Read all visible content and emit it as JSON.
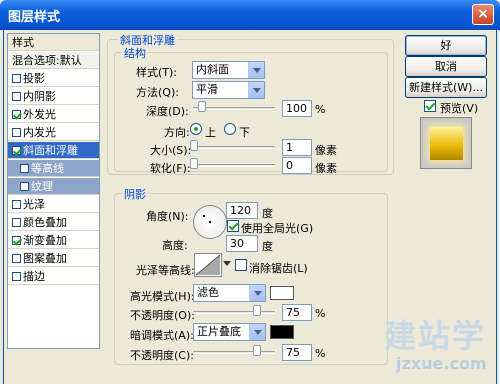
{
  "window": {
    "title": "图层样式",
    "close": "×"
  },
  "styles_list": {
    "header": "样式",
    "blend_options": "混合选项:默认",
    "items": [
      {
        "label": "投影",
        "checked": false
      },
      {
        "label": "内阴影",
        "checked": false
      },
      {
        "label": "外发光",
        "checked": true
      },
      {
        "label": "内发光",
        "checked": false
      },
      {
        "label": "斜面和浮雕",
        "checked": true,
        "selected": true
      },
      {
        "label": "等高线",
        "checked": false,
        "sub": true
      },
      {
        "label": "纹理",
        "checked": false,
        "sub": true
      },
      {
        "label": "光泽",
        "checked": false
      },
      {
        "label": "颜色叠加",
        "checked": false
      },
      {
        "label": "渐变叠加",
        "checked": true
      },
      {
        "label": "图案叠加",
        "checked": false
      },
      {
        "label": "描边",
        "checked": false
      }
    ]
  },
  "bevel": {
    "group_title": "斜面和浮雕",
    "structure_title": "结构",
    "style_label": "样式(T):",
    "style_value": "内斜面",
    "technique_label": "方法(Q):",
    "technique_value": "平滑",
    "depth_label": "深度(D):",
    "depth_value": "100",
    "depth_unit": "%",
    "direction_label": "方向:",
    "direction_up": "上",
    "direction_down": "下",
    "size_label": "大小(S):",
    "size_value": "1",
    "size_unit": "像素",
    "soften_label": "软化(F):",
    "soften_value": "0",
    "soften_unit": "像素"
  },
  "shading": {
    "title": "阴影",
    "angle_label": "角度(N):",
    "angle_value": "120",
    "angle_unit": "度",
    "global_light_label": "使用全局光(G)",
    "altitude_label": "高度:",
    "altitude_value": "30",
    "altitude_unit": "度",
    "gloss_label": "光泽等高线:",
    "anti_alias_label": "消除锯齿(L)",
    "highlight_label": "高光模式(H):",
    "highlight_value": "滤色",
    "highlight_opacity_label": "不透明度(O):",
    "highlight_opacity_value": "75",
    "shadow_label": "暗调模式(A):",
    "shadow_value": "正片叠底",
    "shadow_opacity_label": "不透明度(C):",
    "shadow_opacity_value": "75",
    "percent": "%",
    "highlight_color": "#ffffff",
    "shadow_color": "#000000"
  },
  "buttons": {
    "ok": "好",
    "cancel": "取消",
    "new_style": "新建样式(W)...",
    "preview": "预览(V)"
  },
  "watermark": {
    "cn": "建站学",
    "url": "jzxue.com"
  }
}
